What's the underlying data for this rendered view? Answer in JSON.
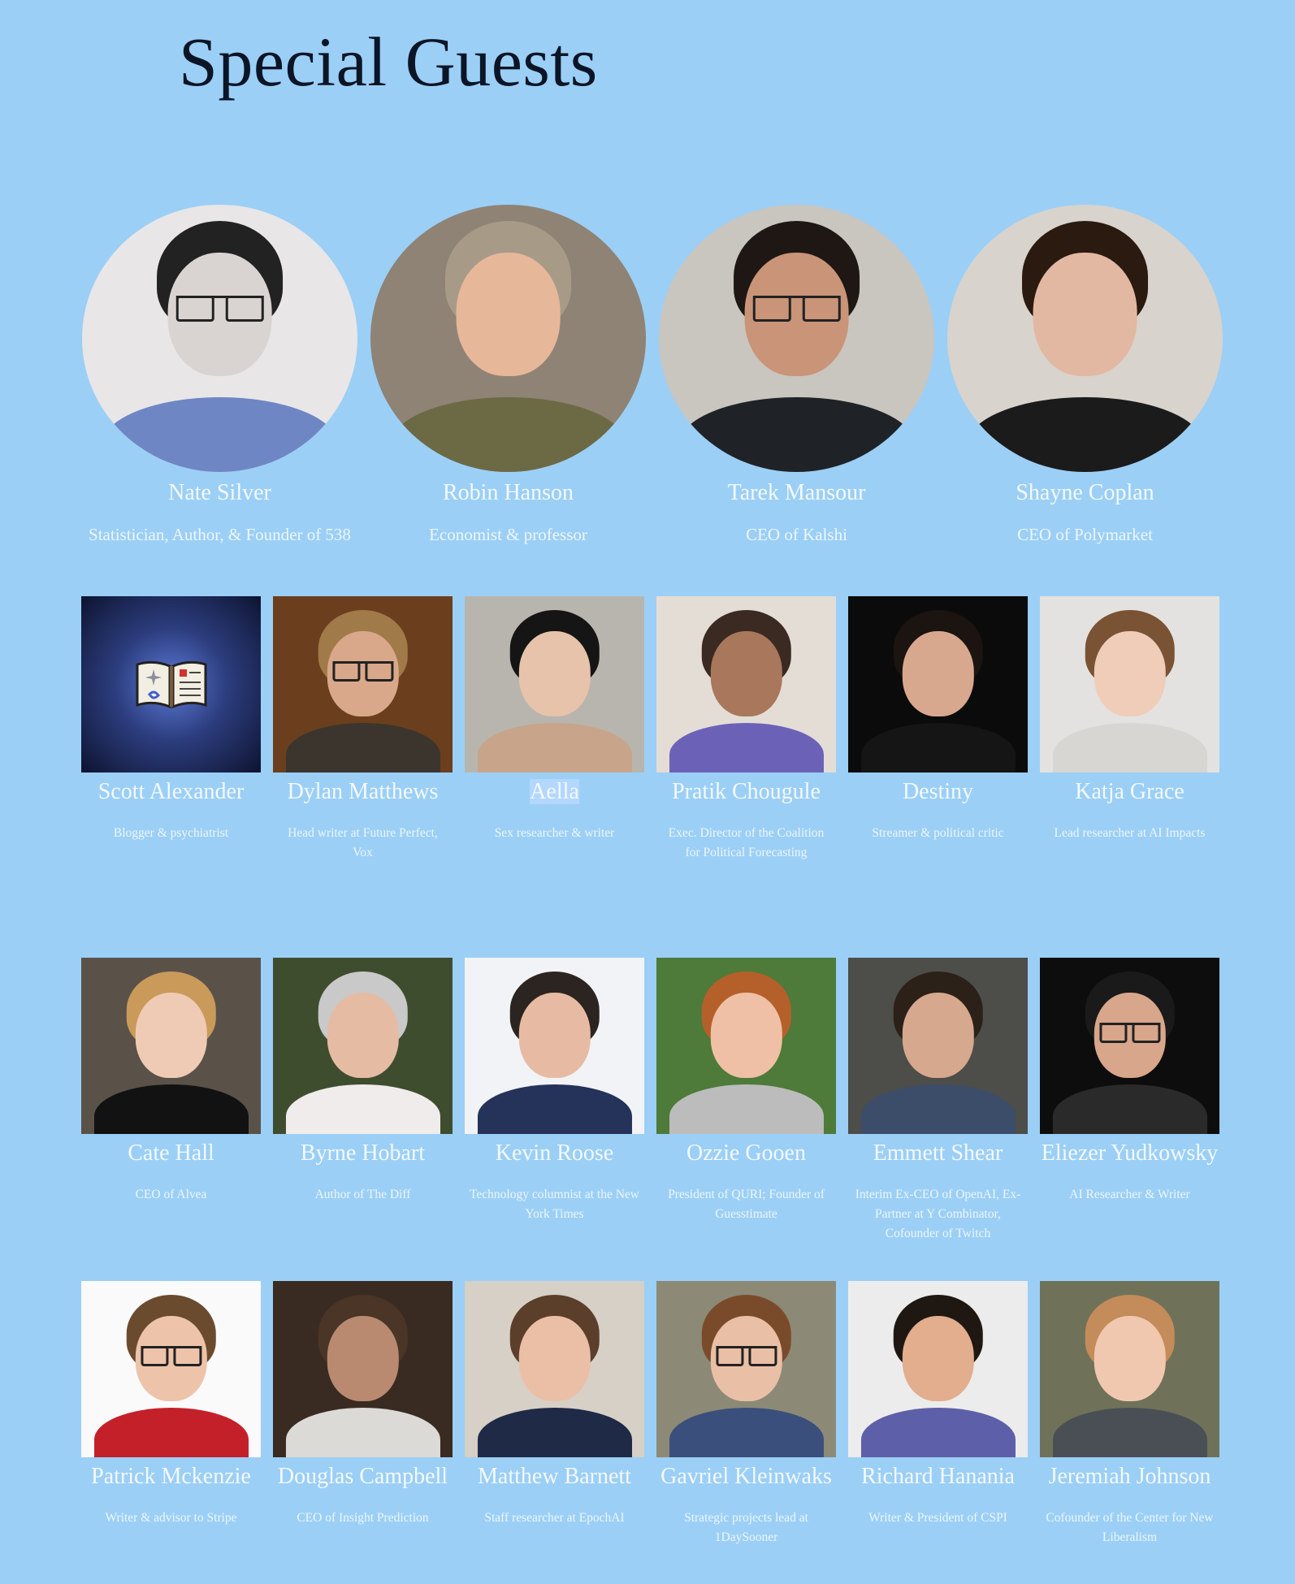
{
  "page": {
    "title": "Special Guests"
  },
  "featured_guests": [
    {
      "name": "Nate Silver",
      "role": "Statistician, Author, & Founder of 538",
      "bg": "#e8e6e7",
      "skin": "#d9d4d2",
      "hair": "#222222",
      "shirt": "#6f86c4",
      "glasses": true
    },
    {
      "name": "Robin Hanson",
      "role": "Economist & professor",
      "bg": "#8f8375",
      "skin": "#e7b79a",
      "hair": "#a79b88",
      "shirt": "#6c6a45",
      "glasses": false
    },
    {
      "name": "Tarek Mansour",
      "role": "CEO of Kalshi",
      "bg": "#c9c5bf",
      "skin": "#c99478",
      "hair": "#1e1713",
      "shirt": "#1f2328",
      "glasses": true
    },
    {
      "name": "Shayne Coplan",
      "role": "CEO of Polymarket",
      "bg": "#d8d3cc",
      "skin": "#e2b8a3",
      "hair": "#2a1a10",
      "shirt": "#1b1b1b",
      "glasses": false
    }
  ],
  "guest_rows": [
    [
      {
        "name": "Scott Alexander",
        "role": "Blogger & psychiatrist",
        "icon": "book-icon"
      },
      {
        "name": "Dylan Matthews",
        "role": "Head writer at Future Perfect, Vox",
        "bg": "#6b3f1e",
        "skin": "#d9a88a",
        "hair": "#a07a48",
        "shirt": "#3b352e",
        "glasses": true
      },
      {
        "name": "Aella",
        "role": "Sex researcher & writer",
        "bg": "#b8b5ae",
        "skin": "#e6c3aa",
        "hair": "#151515",
        "shirt": "#c8a48a",
        "glasses": false,
        "highlight": true
      },
      {
        "name": "Pratik Chougule",
        "role": "Exec. Director of the Coalition for Political Forecasting",
        "bg": "#e4ddd6",
        "skin": "#a9775c",
        "hair": "#3a2a22",
        "shirt": "#6b62b8",
        "glasses": false
      },
      {
        "name": "Destiny",
        "role": "Streamer & political critic",
        "bg": "#0b0b0b",
        "skin": "#d8a88e",
        "hair": "#1b1410",
        "shirt": "#151515",
        "glasses": false
      },
      {
        "name": "Katja Grace",
        "role": "Lead researcher at AI Impacts",
        "bg": "#e3e2e0",
        "skin": "#efcdb9",
        "hair": "#7a5234",
        "shirt": "#d8d6d2",
        "glasses": false
      }
    ],
    [
      {
        "name": "Cate Hall",
        "role": "CEO of Alvea",
        "bg": "#5a5249",
        "skin": "#efcbb6",
        "hair": "#c99a5a",
        "shirt": "#121212",
        "glasses": false
      },
      {
        "name": "Byrne Hobart",
        "role": "Author of The Diff",
        "bg": "#3f4d2f",
        "skin": "#e6bba4",
        "hair": "#c9c9c9",
        "shirt": "#f0ecec",
        "glasses": false
      },
      {
        "name": "Kevin Roose",
        "role": "Technology columnist at the New York Times",
        "bg": "#f1f3f6",
        "skin": "#e7bba3",
        "hair": "#2b2420",
        "shirt": "#25325a",
        "glasses": false
      },
      {
        "name": "Ozzie Gooen",
        "role": "President of QURI; Founder of Guesstimate",
        "bg": "#4e7a3a",
        "skin": "#efc0a6",
        "hair": "#b5602a",
        "shirt": "#bcbcbc",
        "glasses": false
      },
      {
        "name": "Emmett Shear",
        "role": "Interim Ex-CEO of OpenAI, Ex-Partner at Y Combinator, Cofounder of Twitch",
        "bg": "#4d4d4a",
        "skin": "#d6a88e",
        "hair": "#2b2119",
        "shirt": "#3c4d6a",
        "glasses": false
      },
      {
        "name": "Eliezer Yudkowsky",
        "role": "AI Researcher & Writer",
        "bg": "#0d0d0d",
        "skin": "#d8a68b",
        "hair": "#1a1a1a",
        "shirt": "#2a2a2a",
        "glasses": true
      }
    ],
    [
      {
        "name": "Patrick Mckenzie",
        "role": "Writer & advisor to Stripe",
        "bg": "#fafafa",
        "skin": "#edc4aa",
        "hair": "#6b4b2e",
        "shirt": "#c4202a",
        "glasses": true
      },
      {
        "name": "Douglas Campbell",
        "role": "CEO of Insight Prediction",
        "bg": "#3a2b22",
        "skin": "#b98a70",
        "hair": "#4a3526",
        "shirt": "#dcdad6",
        "glasses": false
      },
      {
        "name": "Matthew Barnett",
        "role": "Staff researcher at EpochAI",
        "bg": "#d6d0c6",
        "skin": "#ebbfa5",
        "hair": "#5b3f2a",
        "shirt": "#1e2a46",
        "glasses": false
      },
      {
        "name": "Gavriel Kleinwaks",
        "role": "Strategic projects lead at 1DaySooner",
        "bg": "#8c8a76",
        "skin": "#e9c0a6",
        "hair": "#7a4b2b",
        "shirt": "#3b4f7c",
        "glasses": true
      },
      {
        "name": "Richard Hanania",
        "role": "Writer & President of CSPI",
        "bg": "#ececec",
        "skin": "#e2ae8e",
        "hair": "#1f1712",
        "shirt": "#5d5fa8",
        "glasses": false
      },
      {
        "name": "Jeremiah Johnson",
        "role": "Cofounder of the Center for New Liberalism",
        "bg": "#6f7259",
        "skin": "#f0c8b0",
        "hair": "#c48c5a",
        "shirt": "#4a4f55",
        "glasses": false
      }
    ]
  ]
}
